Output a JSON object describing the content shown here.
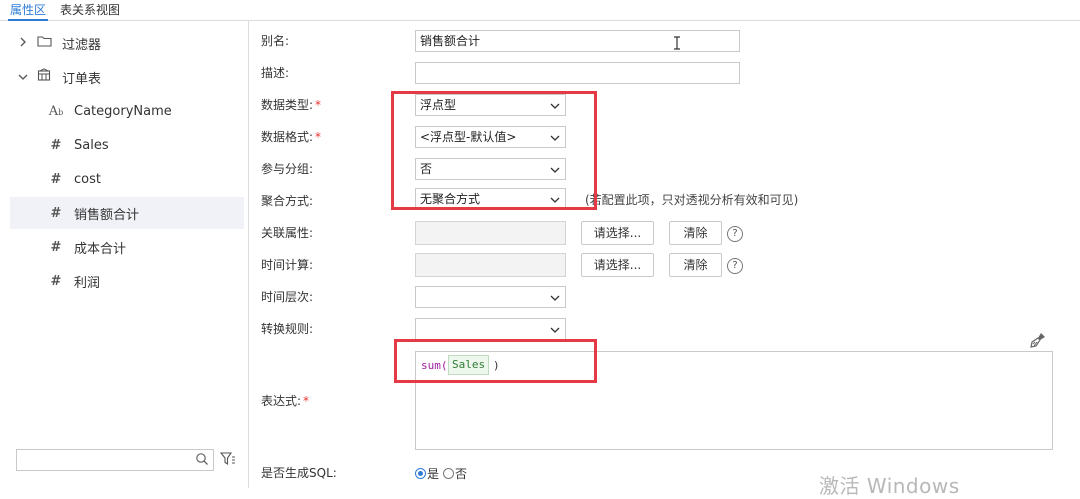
{
  "tabs": [
    {
      "label": "属性区",
      "active": true
    },
    {
      "label": "表关系视图",
      "active": false
    }
  ],
  "tree": {
    "filter_group": {
      "label": "过滤器",
      "icon": "folder-icon"
    },
    "table_group": {
      "label": "订单表",
      "icon": "table-icon"
    },
    "fields": [
      {
        "label": "CategoryName",
        "type": "text",
        "icon": "text-field-icon"
      },
      {
        "label": "Sales",
        "type": "number",
        "icon": "hash-icon"
      },
      {
        "label": "cost",
        "type": "number",
        "icon": "hash-icon"
      },
      {
        "label": "销售额合计",
        "type": "number",
        "icon": "hash-icon",
        "selected": true
      },
      {
        "label": "成本合计",
        "type": "number",
        "icon": "hash-icon"
      },
      {
        "label": "利润",
        "type": "number",
        "icon": "hash-icon"
      }
    ],
    "search": {
      "value": "",
      "placeholder": ""
    }
  },
  "form": {
    "alias": {
      "label": "别名:",
      "value": "销售额合计"
    },
    "description": {
      "label": "描述:",
      "value": ""
    },
    "data_type": {
      "label": "数据类型:",
      "required": "*",
      "value": "浮点型"
    },
    "data_format": {
      "label": "数据格式:",
      "required": "*",
      "value": "<浮点型-默认值>"
    },
    "grouping": {
      "label": "参与分组:",
      "value": "否"
    },
    "aggregation": {
      "label": "聚合方式:",
      "value": "无聚合方式",
      "hint": "(若配置此项，只对透视分析有效和可见)"
    },
    "related_attr": {
      "label": "关联属性:",
      "value": "",
      "choose": "请选择...",
      "clear": "清除",
      "help": "?"
    },
    "time_calc": {
      "label": "时间计算:",
      "value": "",
      "choose": "请选择...",
      "clear": "清除",
      "help": "?"
    },
    "time_level": {
      "label": "时间层次:",
      "value": ""
    },
    "convert_rule": {
      "label": "转换规则:",
      "value": ""
    },
    "expression": {
      "label": "表达式:",
      "required": "*",
      "fn": "sum(",
      "arg": "Sales",
      "close": ")"
    },
    "generate_sql": {
      "label": "是否生成SQL:",
      "yes": "是",
      "no": "否",
      "selected": "是"
    }
  },
  "watermark": "激活 Windows",
  "colors": {
    "accent": "#2f7cd8",
    "highlight": "#e53945",
    "required": "#e53935"
  }
}
